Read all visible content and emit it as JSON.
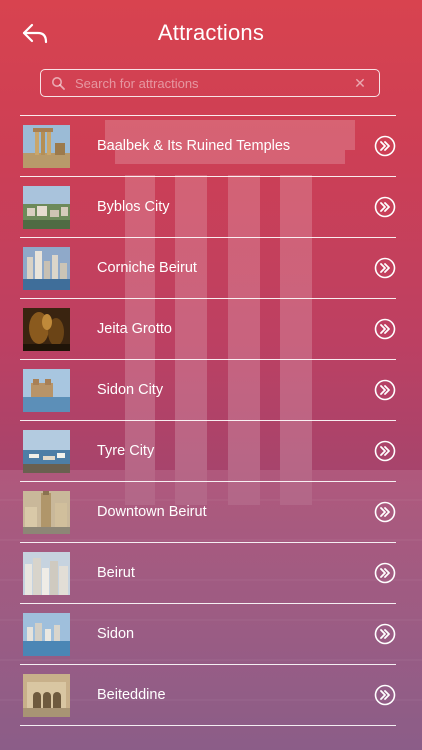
{
  "header": {
    "title": "Attractions",
    "back_icon": "back-arrow-icon"
  },
  "search": {
    "placeholder": "Search for attractions",
    "value": "",
    "clear_icon": "close-icon"
  },
  "items": [
    {
      "label": "Baalbek & Its Ruined Temples",
      "thumb": "ruins"
    },
    {
      "label": "Byblos City",
      "thumb": "city-hill"
    },
    {
      "label": "Corniche Beirut",
      "thumb": "skyline-sea"
    },
    {
      "label": "Jeita Grotto",
      "thumb": "cave"
    },
    {
      "label": "Sidon City",
      "thumb": "castle-sea"
    },
    {
      "label": "Tyre City",
      "thumb": "harbor"
    },
    {
      "label": "Downtown Beirut",
      "thumb": "tower"
    },
    {
      "label": "Beirut",
      "thumb": "dense-city"
    },
    {
      "label": "Sidon",
      "thumb": "coast-city"
    },
    {
      "label": "Beiteddine",
      "thumb": "palace"
    }
  ],
  "colors": {
    "gradient_top": "#d8434f",
    "gradient_bottom": "#7d4a7a",
    "foreground": "#ffffff"
  }
}
